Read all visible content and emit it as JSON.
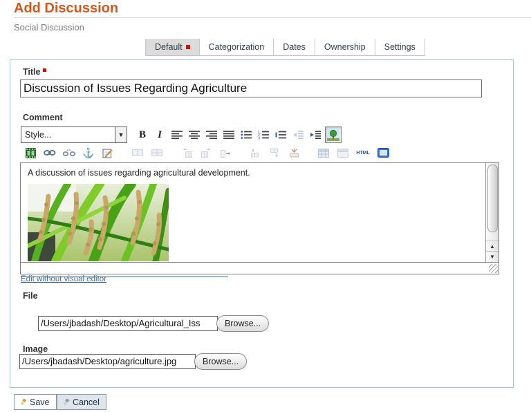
{
  "page": {
    "title": "Add Discussion",
    "subtitle": "Social Discussion"
  },
  "tabs": [
    {
      "label": "Default",
      "active": true,
      "required_marker": true
    },
    {
      "label": "Categorization",
      "active": false
    },
    {
      "label": "Dates",
      "active": false
    },
    {
      "label": "Ownership",
      "active": false
    },
    {
      "label": "Settings",
      "active": false
    }
  ],
  "form": {
    "title": {
      "label": "Title",
      "required": true,
      "value": "Discussion of Issues Regarding Agriculture"
    },
    "comment": {
      "label": "Comment",
      "style_select": {
        "value": "Style..."
      },
      "toolbar_row1_icons": [
        "style-select",
        "bold",
        "italic",
        "align-left",
        "align-center",
        "align-right",
        "align-justify",
        "bulleted-list-icon",
        "numbered-list-icon",
        "indent-list-icon",
        "outdent-icon",
        "indent-icon",
        "insert-image-icon"
      ],
      "toolbar_row2_icons": [
        "insert-video-icon",
        "insert-link-icon",
        "remove-link-icon",
        "insert-anchor-icon",
        "edit-note-icon",
        "merge-cell-icon",
        "split-cell-icon",
        "add-column-before-icon",
        "add-column-after-icon",
        "delete-column-icon",
        "add-row-before-icon",
        "add-row-after-icon",
        "delete-row-icon",
        "insert-table-icon",
        "table-properties-icon",
        "html-source-icon",
        "source-view-icon"
      ],
      "html_button_label": "HTML",
      "content_text": "A discussion of issues regarding agricultural development.",
      "content_image": "rice-plants-photo",
      "edit_link_label": "Edit without visual editor"
    },
    "file": {
      "label": "File",
      "value": "/Users/jbadash/Desktop/Agricultural_Iss",
      "browse_label": "Browse..."
    },
    "image": {
      "label": "Image",
      "value": "/Users/jbadash/Desktop/agriculture.jpg",
      "browse_label": "Browse..."
    }
  },
  "actions": {
    "save": "Save",
    "cancel": "Cancel"
  },
  "colors": {
    "heading": "#d4581e",
    "required_marker": "#cc1100",
    "tab_active_bg": "#dcdcdc",
    "fieldset_border": "#a9bec7",
    "link": "#4a6982"
  }
}
